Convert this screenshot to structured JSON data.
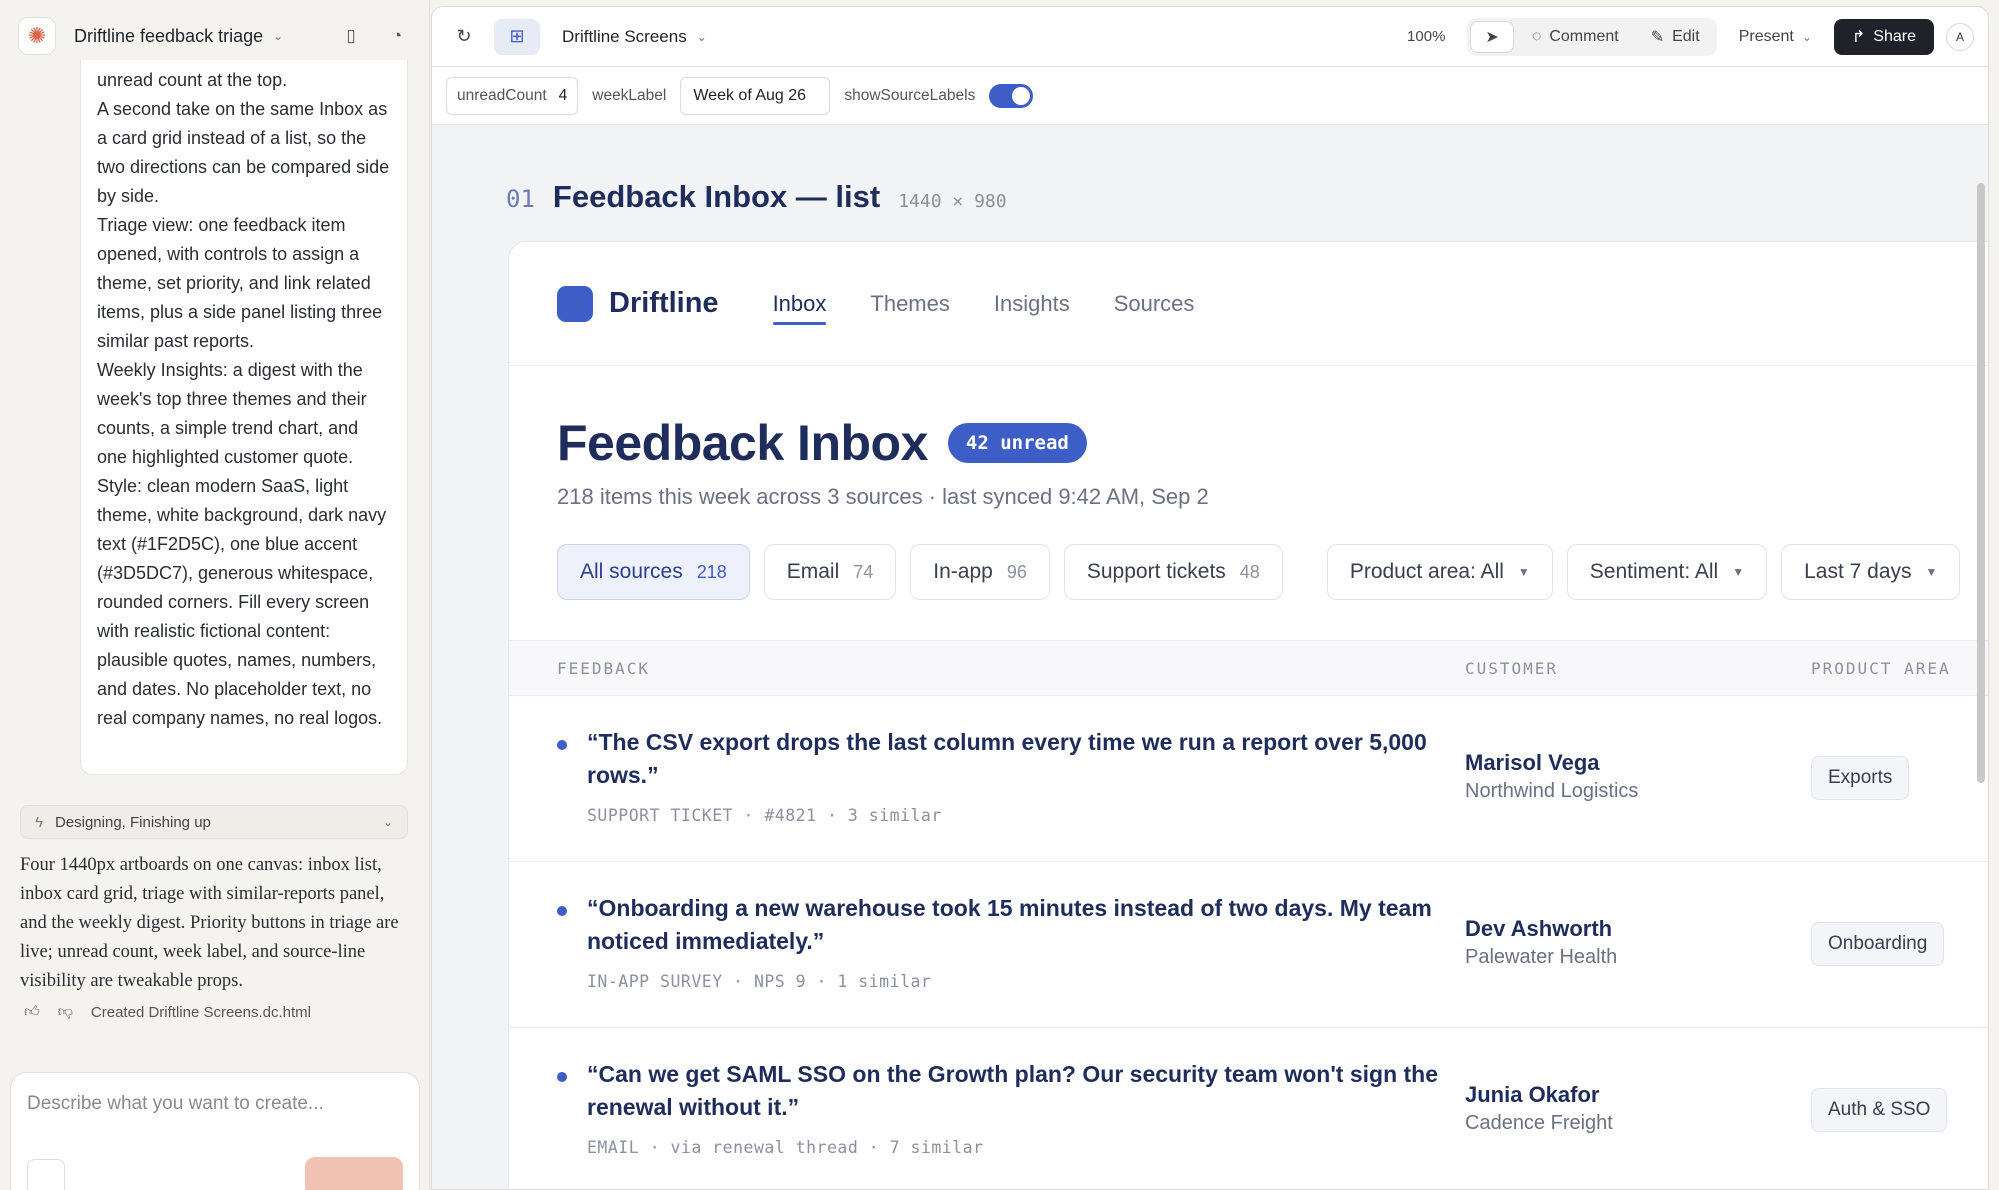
{
  "chat": {
    "project_title": "Driftline feedback triage",
    "message_paragraphs": [
      "unread count at the top.",
      "A second take on the same Inbox as a card grid instead of a list, so the two directions can be compared side by side.",
      "Triage view: one feedback item opened, with controls to assign a theme, set priority, and link related items, plus a side panel listing three similar past reports.",
      "Weekly Insights: a digest with the week's top three themes and their counts, a simple trend chart, and one highlighted customer quote.",
      "Style: clean modern SaaS, light theme, white background, dark navy text (#1F2D5C), one blue accent (#3D5DC7), generous whitespace, rounded corners. Fill every screen with realistic fictional content: plausible quotes, names, numbers, and dates. No placeholder text, no real company names, no real logos."
    ],
    "status": "Designing, Finishing up",
    "reply": "Four 1440px artboards on one canvas: inbox list, inbox card grid, triage with similar-reports panel, and the weekly digest. Priority buttons in triage are live; unread count, week label, and source-line visibility are tweakable props.",
    "created_file": "Created Driftline Screens.dc.html",
    "composer_placeholder": "Describe what you want to create..."
  },
  "toolbar": {
    "doc_title": "Driftline Screens",
    "zoom": "100%",
    "comment_label": "Comment",
    "edit_label": "Edit",
    "present_label": "Present",
    "share_label": "Share",
    "avatar_initial": "A"
  },
  "props": {
    "unread_label": "unreadCount",
    "unread_value": "4",
    "week_label": "weekLabel",
    "week_value": "Week of Aug 26",
    "source_label": "showSourceLabels",
    "source_on": true
  },
  "artboard": {
    "number": "01",
    "title": "Feedback Inbox — list",
    "dimensions": "1440 × 980"
  },
  "app": {
    "brand": "Driftline",
    "nav": [
      "Inbox",
      "Themes",
      "Insights",
      "Sources"
    ],
    "page_title": "Feedback Inbox",
    "unread_badge": "42 unread",
    "subtitle": "218 items this week across 3 sources · last synced 9:42 AM, Sep 2",
    "source_filters": [
      {
        "label": "All sources",
        "count": "218"
      },
      {
        "label": "Email",
        "count": "74"
      },
      {
        "label": "In-app",
        "count": "96"
      },
      {
        "label": "Support tickets",
        "count": "48"
      }
    ],
    "dropdown_filters": [
      "Product area: All",
      "Sentiment: All",
      "Last 7 days"
    ],
    "columns": [
      "FEEDBACK",
      "CUSTOMER",
      "PRODUCT AREA"
    ],
    "rows": [
      {
        "quote": "“The CSV export drops the last column every time we run a report over 5,000 rows.”",
        "meta": "SUPPORT TICKET · #4821 · 3 similar",
        "customer": "Marisol Vega",
        "company": "Northwind Logistics",
        "area": "Exports"
      },
      {
        "quote": "“Onboarding a new warehouse took 15 minutes instead of two days. My team noticed immediately.”",
        "meta": "IN-APP SURVEY · NPS 9 · 1 similar",
        "customer": "Dev Ashworth",
        "company": "Palewater Health",
        "area": "Onboarding"
      },
      {
        "quote": "“Can we get SAML SSO on the Growth plan? Our security team won't sign the renewal without it.”",
        "meta": "EMAIL · via renewal thread · 7 similar",
        "customer": "Junia Okafor",
        "company": "Cadence Freight",
        "area": "Auth & SSO"
      }
    ]
  },
  "colors": {
    "accent": "#3D5DC7",
    "navy": "#1F2D5C"
  }
}
